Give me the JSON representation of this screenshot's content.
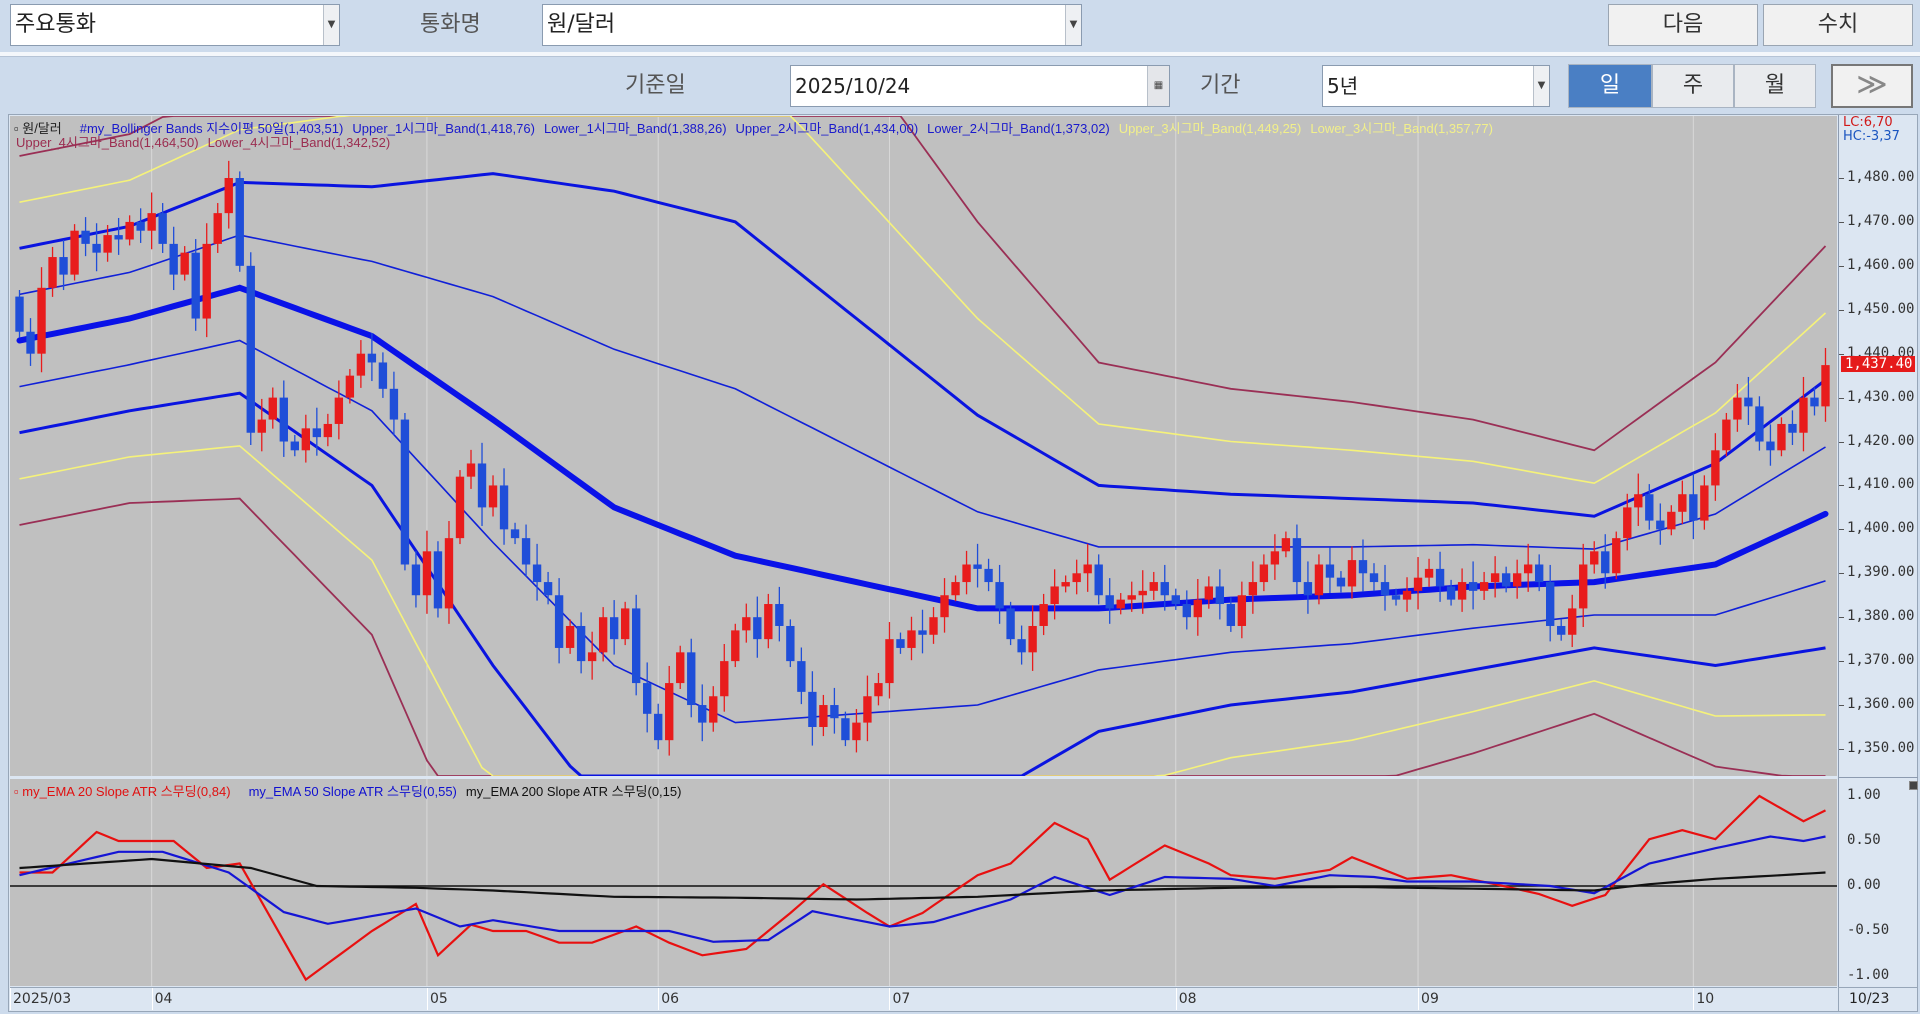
{
  "toolbar": {
    "category_select": "주요통화",
    "currency_label": "통화명",
    "currency_select": "원/달러",
    "next_button": "다음",
    "values_button": "수치",
    "base_date_label": "기준일",
    "base_date": "2025/10/24",
    "period_label": "기간",
    "period_select": "5년",
    "interval_tabs": [
      {
        "label": "일",
        "active": true
      },
      {
        "label": "주",
        "active": false
      },
      {
        "label": "월",
        "active": false
      }
    ],
    "more_button": "≫"
  },
  "chart_data": {
    "type": "candlestick",
    "main": {
      "symbol": "원/달러",
      "legend_row1": [
        {
          "text": "#my_Bollinger Bands 지수이평 50일(1,403,51)",
          "color": "#1a1acc"
        },
        {
          "text": "Upper_1시그마_Band(1,418,76)",
          "color": "#1a1acc"
        },
        {
          "text": "Lower_1시그마_Band(1,388,26)",
          "color": "#1a1acc"
        },
        {
          "text": "Upper_2시그마_Band(1,434,00)",
          "color": "#1a1acc"
        },
        {
          "text": "Lower_2시그마_Band(1,373,02)",
          "color": "#1a1acc"
        },
        {
          "text": "Upper_3시그마_Band(1,449,25)",
          "color": "#f2f08a"
        },
        {
          "text": "Lower_3시그마_Band(1,357,77)",
          "color": "#f2f08a"
        }
      ],
      "legend_row2": [
        {
          "text": "Upper_4시그마_Band(1,464,50)",
          "color": "#9b2d50"
        },
        {
          "text": "Lower_4시그마_Band(1,342,52)",
          "color": "#9b2d50"
        }
      ],
      "lc": "LC:6,70",
      "hc": "HC:-3,37",
      "last_price_label": "1,437.40",
      "last_price": 1437.4,
      "ylim": [
        1340,
        1494
      ],
      "y_ticks": [
        1480,
        1470,
        1460,
        1450,
        1440,
        1430,
        1420,
        1410,
        1400,
        1390,
        1380,
        1370,
        1360,
        1350
      ],
      "y_tick_labels": [
        "1,480.00",
        "1,470.00",
        "1,460.00",
        "1,450.00",
        "1,440.00",
        "1,430.00",
        "1,420.00",
        "1,410.00",
        "1,400.00",
        "1,390.00",
        "1,380.00",
        "1,370.00",
        "1,360.00",
        "1,350.00"
      ],
      "first_open": 1453,
      "closes": [
        1445,
        1440,
        1455,
        1462,
        1458,
        1468,
        1465,
        1463,
        1467,
        1466,
        1470,
        1468,
        1472,
        1465,
        1458,
        1463,
        1448,
        1465,
        1472,
        1480,
        1460,
        1422,
        1425,
        1430,
        1420,
        1418,
        1423,
        1421,
        1424,
        1430,
        1435,
        1440,
        1438,
        1432,
        1425,
        1392,
        1385,
        1395,
        1382,
        1398,
        1412,
        1415,
        1405,
        1410,
        1400,
        1398,
        1392,
        1388,
        1385,
        1373,
        1378,
        1370,
        1372,
        1380,
        1375,
        1382,
        1365,
        1358,
        1352,
        1365,
        1372,
        1360,
        1356,
        1362,
        1370,
        1377,
        1380,
        1375,
        1383,
        1378,
        1370,
        1363,
        1355,
        1360,
        1357,
        1352,
        1356,
        1362,
        1365,
        1375,
        1373,
        1377,
        1376,
        1380,
        1385,
        1388,
        1392,
        1391,
        1388,
        1382,
        1375,
        1372,
        1378,
        1383,
        1387,
        1388,
        1390,
        1392,
        1385,
        1382,
        1384,
        1385,
        1386,
        1388,
        1385,
        1383,
        1380,
        1384,
        1387,
        1383,
        1378,
        1385,
        1388,
        1392,
        1395,
        1398,
        1388,
        1385,
        1392,
        1389,
        1387,
        1393,
        1390,
        1388,
        1385,
        1384,
        1386,
        1389,
        1391,
        1387,
        1384,
        1388,
        1386,
        1388,
        1390,
        1387,
        1390,
        1392,
        1388,
        1378,
        1376,
        1382,
        1392,
        1395,
        1390,
        1398,
        1405,
        1408,
        1402,
        1400,
        1404,
        1408,
        1402,
        1410,
        1418,
        1425,
        1430,
        1428,
        1420,
        1418,
        1424,
        1422,
        1430,
        1428,
        1437.4
      ],
      "bollinger": {
        "sigma_multipliers": [
          1,
          2,
          3,
          4
        ],
        "keypoints": [
          [
            0,
            1443,
            10.5
          ],
          [
            10,
            1448,
            10.5
          ],
          [
            20,
            1455,
            12
          ],
          [
            32,
            1444,
            17
          ],
          [
            43,
            1425,
            28
          ],
          [
            54,
            1405,
            36
          ],
          [
            65,
            1394,
            38
          ],
          [
            76,
            1388,
            30
          ],
          [
            87,
            1382,
            22
          ],
          [
            98,
            1382,
            14
          ],
          [
            110,
            1384,
            12
          ],
          [
            121,
            1385,
            11
          ],
          [
            132,
            1387,
            9.5
          ],
          [
            143,
            1388,
            7.5
          ],
          [
            154,
            1392,
            11.5
          ],
          [
            164,
            1403.51,
            15.25
          ]
        ]
      }
    },
    "indicator": {
      "legend": [
        {
          "text": "my_EMA 20 Slope ATR 스무딩(0,84)",
          "color": "#e01010"
        },
        {
          "text": "my_EMA 50 Slope ATR 스무딩(0,55)",
          "color": "#1010d0"
        },
        {
          "text": "my_EMA 200 Slope ATR 스무딩(0,15)",
          "color": "#111111"
        }
      ],
      "ylim": [
        -1,
        1
      ],
      "y_ticks": [
        1,
        0.5,
        0,
        -0.5,
        -1
      ],
      "y_tick_labels": [
        "1.00",
        "0.50",
        "0.00",
        "-0.50",
        "-1.00"
      ],
      "series": [
        {
          "name": "EMA20",
          "color": "#e81010",
          "points": [
            [
              0,
              0.15
            ],
            [
              3,
              0.15
            ],
            [
              7,
              0.6
            ],
            [
              9,
              0.5
            ],
            [
              14,
              0.5
            ],
            [
              17,
              0.2
            ],
            [
              20,
              0.25
            ],
            [
              26,
              -1.04
            ],
            [
              32,
              -0.5
            ],
            [
              36,
              -0.2
            ],
            [
              38,
              -0.77
            ],
            [
              41,
              -0.43
            ],
            [
              43,
              -0.5
            ],
            [
              46,
              -0.5
            ],
            [
              49,
              -0.63
            ],
            [
              52,
              -0.63
            ],
            [
              56,
              -0.45
            ],
            [
              59,
              -0.63
            ],
            [
              62,
              -0.77
            ],
            [
              66,
              -0.7
            ],
            [
              70,
              -0.3
            ],
            [
              73,
              0.02
            ],
            [
              77,
              -0.3
            ],
            [
              79,
              -0.45
            ],
            [
              82,
              -0.3
            ],
            [
              87,
              0.12
            ],
            [
              90,
              0.25
            ],
            [
              94,
              0.7
            ],
            [
              97,
              0.52
            ],
            [
              99,
              0.07
            ],
            [
              104,
              0.45
            ],
            [
              108,
              0.25
            ],
            [
              110,
              0.12
            ],
            [
              114,
              0.08
            ],
            [
              119,
              0.18
            ],
            [
              121,
              0.32
            ],
            [
              126,
              0.08
            ],
            [
              130,
              0.12
            ],
            [
              134,
              0.02
            ],
            [
              138,
              -0.09
            ],
            [
              141,
              -0.22
            ],
            [
              144,
              -0.1
            ],
            [
              148,
              0.52
            ],
            [
              151,
              0.62
            ],
            [
              154,
              0.52
            ],
            [
              158,
              1.0
            ],
            [
              162,
              0.72
            ],
            [
              164,
              0.84
            ]
          ]
        },
        {
          "name": "EMA50",
          "color": "#1515d5",
          "points": [
            [
              0,
              0.12
            ],
            [
              9,
              0.38
            ],
            [
              13,
              0.38
            ],
            [
              19,
              0.15
            ],
            [
              24,
              -0.29
            ],
            [
              28,
              -0.42
            ],
            [
              36,
              -0.25
            ],
            [
              40,
              -0.45
            ],
            [
              43,
              -0.38
            ],
            [
              49,
              -0.5
            ],
            [
              54,
              -0.5
            ],
            [
              59,
              -0.5
            ],
            [
              63,
              -0.62
            ],
            [
              68,
              -0.6
            ],
            [
              72,
              -0.28
            ],
            [
              79,
              -0.45
            ],
            [
              83,
              -0.4
            ],
            [
              90,
              -0.15
            ],
            [
              94,
              0.1
            ],
            [
              99,
              -0.1
            ],
            [
              104,
              0.1
            ],
            [
              110,
              0.08
            ],
            [
              114,
              0.0
            ],
            [
              119,
              0.12
            ],
            [
              123,
              0.1
            ],
            [
              126,
              0.05
            ],
            [
              132,
              0.05
            ],
            [
              139,
              0.0
            ],
            [
              143,
              -0.08
            ],
            [
              148,
              0.25
            ],
            [
              154,
              0.42
            ],
            [
              159,
              0.55
            ],
            [
              162,
              0.5
            ],
            [
              164,
              0.55
            ]
          ]
        },
        {
          "name": "EMA200",
          "color": "#111111",
          "points": [
            [
              0,
              0.2
            ],
            [
              12,
              0.3
            ],
            [
              21,
              0.2
            ],
            [
              27,
              0.0
            ],
            [
              36,
              -0.02
            ],
            [
              43,
              -0.05
            ],
            [
              54,
              -0.12
            ],
            [
              65,
              -0.13
            ],
            [
              76,
              -0.15
            ],
            [
              87,
              -0.12
            ],
            [
              98,
              -0.05
            ],
            [
              110,
              -0.02
            ],
            [
              121,
              -0.01
            ],
            [
              132,
              -0.03
            ],
            [
              143,
              -0.05
            ],
            [
              148,
              0.02
            ],
            [
              154,
              0.08
            ],
            [
              160,
              0.12
            ],
            [
              164,
              0.15
            ]
          ]
        }
      ]
    },
    "x_labels": [
      {
        "idx": 0,
        "label": "2025/03"
      },
      {
        "idx": 12,
        "label": "04"
      },
      {
        "idx": 37,
        "label": "05"
      },
      {
        "idx": 58,
        "label": "06"
      },
      {
        "idx": 79,
        "label": "07"
      },
      {
        "idx": 105,
        "label": "08"
      },
      {
        "idx": 127,
        "label": "09"
      },
      {
        "idx": 152,
        "label": "10"
      }
    ],
    "last_date_label": "10/23",
    "colors": {
      "up": "#e81c1c",
      "down": "#1f4ed8",
      "mid": "#0a12e8",
      "band1": "#1020d8",
      "band2": "#0a14e0",
      "band3": "#f5f27a",
      "band4": "#9a2f55"
    }
  }
}
